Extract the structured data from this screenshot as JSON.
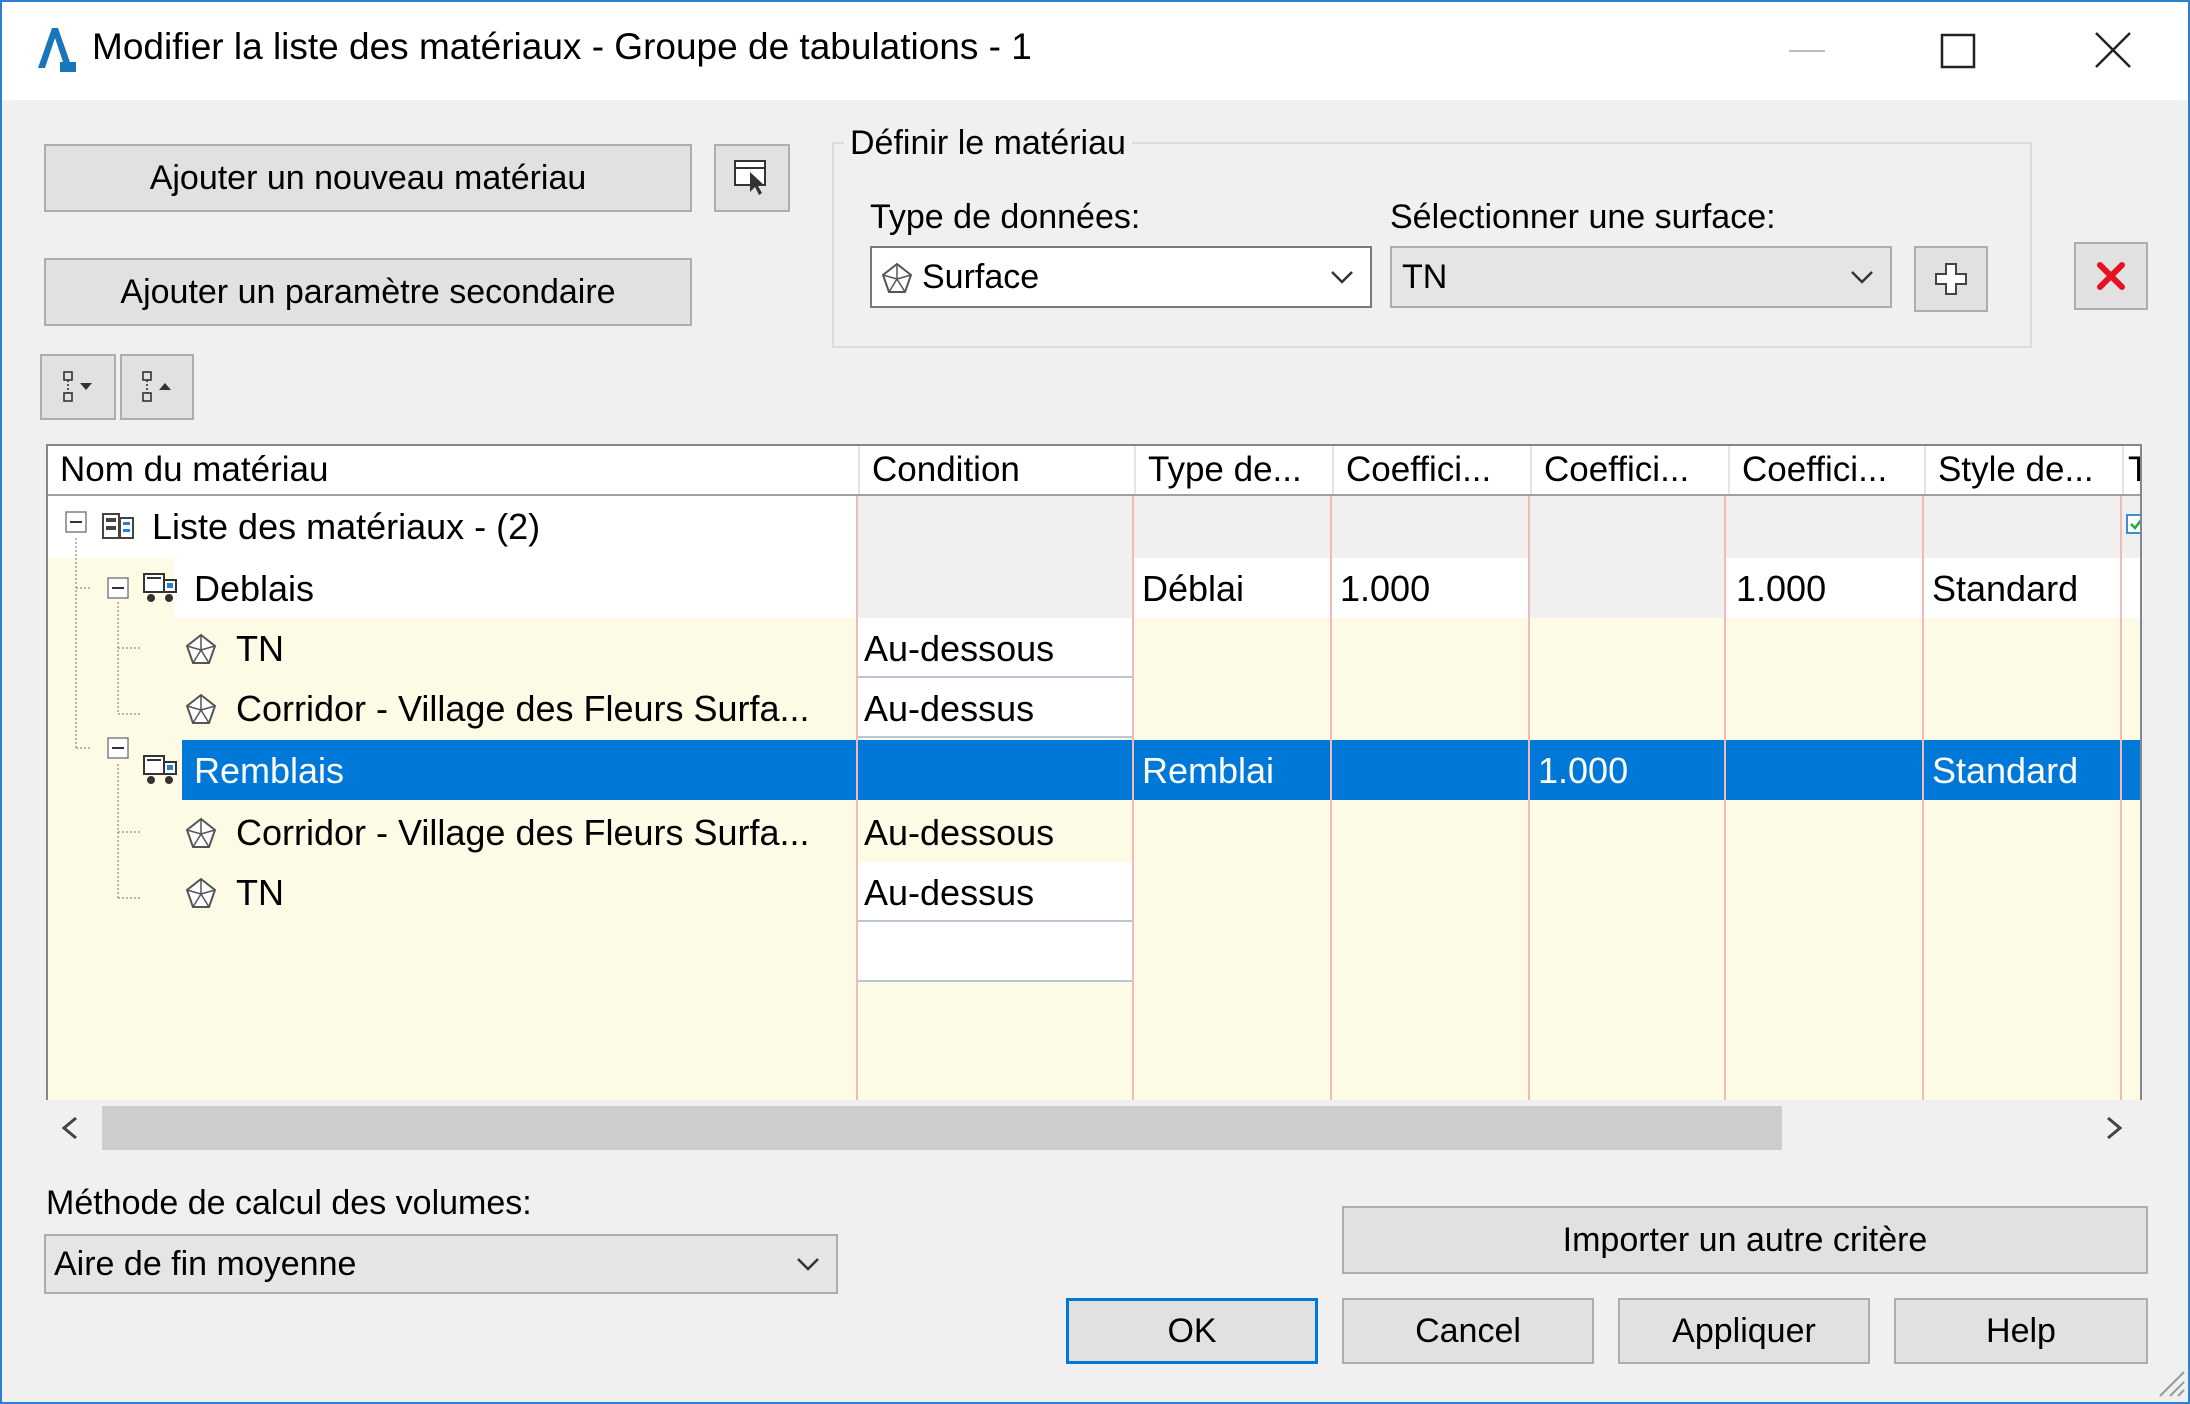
{
  "window": {
    "title": "Modifier la liste des matériaux - Groupe de tabulations - 1"
  },
  "buttons": {
    "add_material": "Ajouter un nouveau matériau",
    "add_secondary": "Ajouter un paramètre secondaire",
    "import_other": "Importer un autre critère",
    "ok": "OK",
    "cancel": "Cancel",
    "apply": "Appliquer",
    "help": "Help"
  },
  "define_material": {
    "group_label": "Définir le matériau",
    "data_type_label": "Type de données:",
    "data_type_value": "Surface",
    "surface_label": "Sélectionner une surface:",
    "surface_value": "TN"
  },
  "grid": {
    "columns": [
      "Nom du matériau",
      "Condition",
      "Type de...",
      "Coeffici...",
      "Coeffici...",
      "Coeffici...",
      "Style de...",
      "T"
    ],
    "rows": [
      {
        "name": "Liste des matériaux - (2)",
        "condition": "",
        "type": "",
        "c1": "",
        "c2": "",
        "c3": "",
        "style": ""
      },
      {
        "name": "Deblais",
        "condition": "",
        "type": "Déblai",
        "c1": "1.000",
        "c2": "",
        "c3": "1.000",
        "style": "Standard"
      },
      {
        "name": "TN",
        "condition": "Au-dessous",
        "type": "",
        "c1": "",
        "c2": "",
        "c3": "",
        "style": ""
      },
      {
        "name": "Corridor - Village des Fleurs Surfa...",
        "condition": "Au-dessus",
        "type": "",
        "c1": "",
        "c2": "",
        "c3": "",
        "style": ""
      },
      {
        "name": "Remblais",
        "condition": "",
        "type": "Remblai",
        "c1": "",
        "c2": "1.000",
        "c3": "",
        "style": "Standard"
      },
      {
        "name": "Corridor - Village des Fleurs Surfa...",
        "condition": "Au-dessous",
        "type": "",
        "c1": "",
        "c2": "",
        "c3": "",
        "style": ""
      },
      {
        "name": "TN",
        "condition": "Au-dessus",
        "type": "",
        "c1": "",
        "c2": "",
        "c3": "",
        "style": ""
      }
    ]
  },
  "volume_method": {
    "label": "Méthode de calcul des volumes:",
    "value": "Aire de fin moyenne"
  },
  "colors": {
    "selection": "#0078d7",
    "rowfill": "#fdfbe6",
    "accent": "#2b7fd4",
    "delete": "#e81123"
  },
  "icons": [
    "autocad-icon",
    "minimize-icon",
    "maximize-icon",
    "close-icon",
    "pick-from-drawing-icon",
    "add-surface-icon",
    "delete-icon",
    "expand-all-icon",
    "collapse-all-icon",
    "surface-icon",
    "material-list-icon",
    "material-truck-icon",
    "scroll-left-icon",
    "scroll-right-icon",
    "resize-grip-icon"
  ]
}
